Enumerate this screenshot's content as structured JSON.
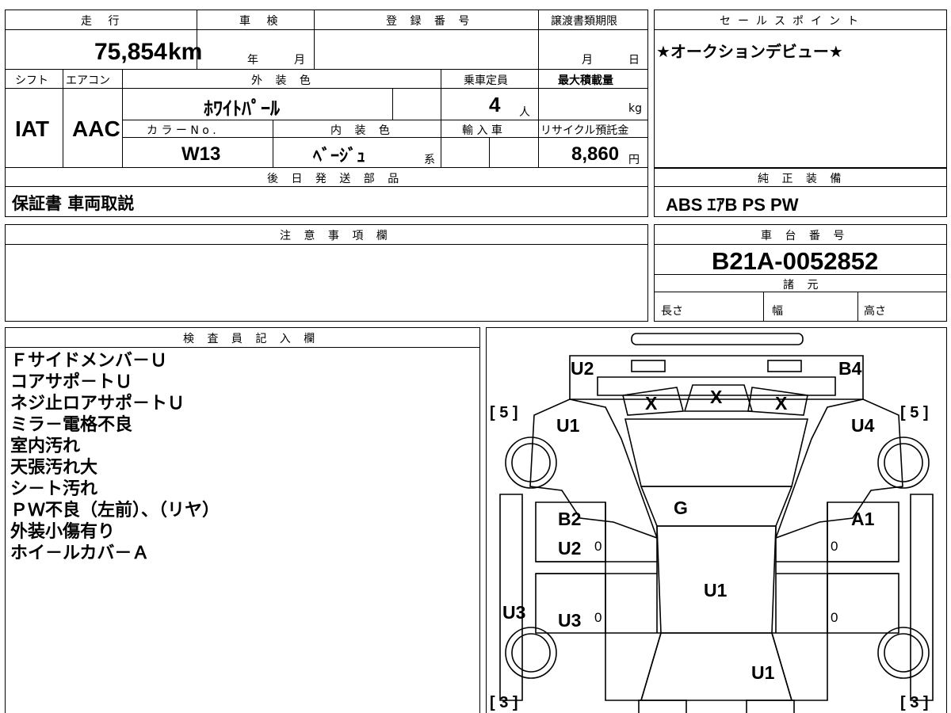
{
  "top_left": {
    "mileage_label": "走 行",
    "mileage_value": "75,854",
    "mileage_unit": "km",
    "shaken_label": "車 検",
    "shaken_year": "年",
    "shaken_month": "月",
    "reg_label": "登 録 番 号",
    "transfer_label": "譲渡書類期限",
    "transfer_month": "月",
    "transfer_day": "日",
    "shift_label": "シフト",
    "ac_label": "エアコン",
    "exterior_label": "外 装 色",
    "capacity_label": "乗車定員",
    "maxload_label": "最大積載量",
    "shift_value": "IAT",
    "ac_value": "AAC",
    "exterior_value": "ﾎﾜｲﾄﾊﾟｰﾙ",
    "capacity_value": "4",
    "capacity_unit": "人",
    "maxload_unit": "kg",
    "color_no_label": "カ ラ ー N o .",
    "interior_label": "内 装 色",
    "import_label": "輸 入 車",
    "recycle_label": "リサイクル預託金",
    "color_no_value": "W13",
    "interior_value": "ﾍﾞｰｼﾞｭ",
    "interior_suffix": "系",
    "recycle_value": "8,860",
    "recycle_unit": "円"
  },
  "sales_point": {
    "label": "セールスポイント",
    "text": "★オークションデビュー★"
  },
  "later_parts": {
    "label": "後 日 発 送 部 品",
    "text": "保証書 車両取説"
  },
  "standard_equipment": {
    "label": "純 正 装 備",
    "text": "ABS ｴｱB PS PW"
  },
  "notes": {
    "label": "注 意 事 項 欄"
  },
  "chassis": {
    "label": "車 台 番 号",
    "value": "B21A-0052852",
    "spec_label": "諸 元",
    "length_label": "長さ",
    "width_label": "幅",
    "height_label": "高さ"
  },
  "inspector": {
    "label": "検 査 員 記 入 欄",
    "lines": [
      "Ｆサイドメンバ－Ｕ",
      "コアサポ－トＵ",
      "ネジ止ロアサポ－トＵ",
      "ミラ－電格不良",
      "室内汚れ",
      "天張汚れ大",
      "シ－ト汚れ",
      "ＰＷ不良（左前）、（リヤ）",
      "外装小傷有り",
      "ホイ－ルカバ－Ａ"
    ]
  },
  "diagram": {
    "marks": {
      "u2_top": "U2",
      "b4": "B4",
      "x_left": "X",
      "x_mid": "X",
      "x_right": "X",
      "u1_front_left": "U1",
      "u4": "U4",
      "g": "G",
      "b2": "B2",
      "u2_left_door": "U2",
      "a1": "A1",
      "u1_roof": "U1",
      "u3_side": "U3",
      "u3_rear_door": "U3",
      "u1_rear": "U1",
      "zero_1": "0",
      "zero_2": "0",
      "zero_3": "0",
      "zero_4": "0"
    },
    "tire_front_left": "[ 5 ]",
    "tire_front_right": "[ 5 ]",
    "tire_rear_left": "[ 3 ]",
    "tire_rear_right": "[ 3 ]"
  }
}
